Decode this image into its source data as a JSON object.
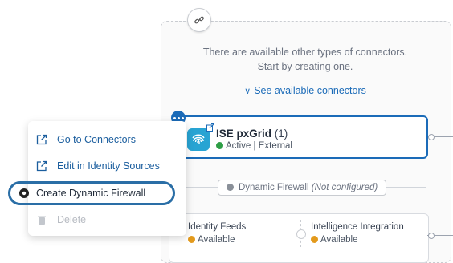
{
  "panel": {
    "message_line1": "There are available other types of connectors.",
    "message_line2": "Start by creating one.",
    "see_connectors": "See available connectors"
  },
  "ise_card": {
    "title": "ISE pxGrid",
    "count": "(1)",
    "status": "Active",
    "separator": "|",
    "type": "External",
    "icon": "fingerprint-icon"
  },
  "dynamic_firewall": {
    "label": "Dynamic Firewall",
    "status": "(Not configured)"
  },
  "feeds": {
    "identity_label": "Identity Feeds",
    "identity_status": "Available",
    "intel_label": "Intelligence Integration",
    "intel_status": "Available"
  },
  "menu": {
    "items": [
      {
        "label": "Go to Connectors",
        "icon": "external-link-icon"
      },
      {
        "label": "Edit in Identity Sources",
        "icon": "external-link-icon"
      },
      {
        "label": "Create Dynamic Firewall",
        "icon": "record-icon"
      },
      {
        "label": "Delete",
        "icon": "trash-icon"
      }
    ]
  },
  "colors": {
    "accent": "#1b6bb8",
    "active": "#2e9e46",
    "available": "#e39a1c",
    "ise_icon_bg": "#28a4d3"
  }
}
